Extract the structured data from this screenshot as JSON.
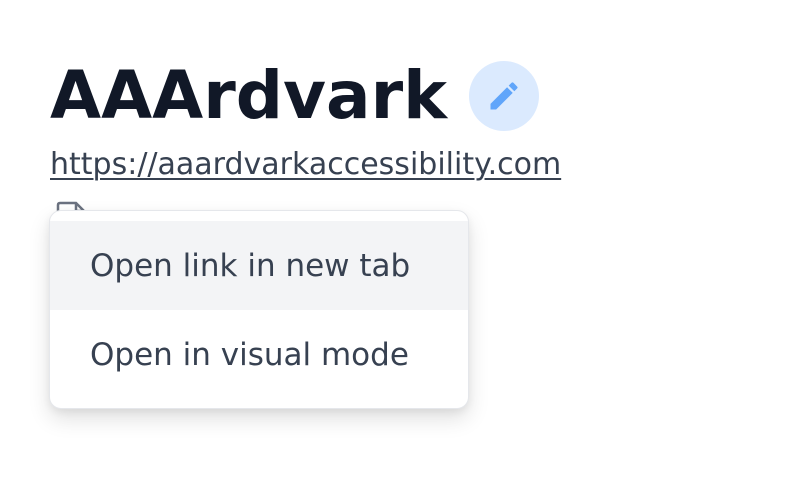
{
  "site": {
    "name": "AAArdvark",
    "url": "https://aaardvarkaccessibility.com"
  },
  "icons": {
    "edit": "pencil-icon",
    "document": "document-icon"
  },
  "colors": {
    "title": "#111827",
    "link": "#374151",
    "edit_button_bg": "#dbeafe",
    "edit_icon": "#60a5fa",
    "menu_hover_bg": "#f3f4f6"
  },
  "menu": {
    "items": [
      {
        "label": "Open link in new tab",
        "active": true
      },
      {
        "label": "Open in visual mode",
        "active": false
      }
    ]
  }
}
